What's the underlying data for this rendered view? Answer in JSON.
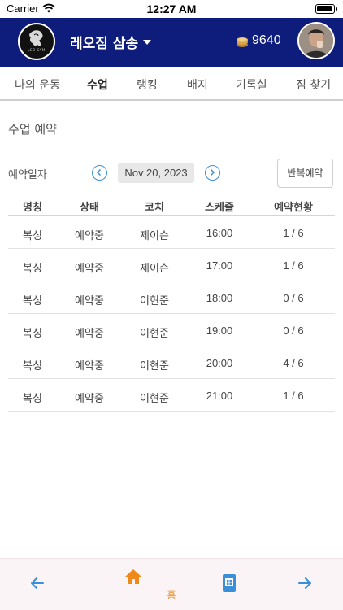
{
  "status_bar": {
    "carrier": "Carrier",
    "time": "12:27 AM"
  },
  "header": {
    "logo_text": "LEO GYM",
    "gym_name": "레오짐 삼송",
    "coins": "9640"
  },
  "tabs": [
    {
      "label": "나의 운동",
      "active": false
    },
    {
      "label": "수업",
      "active": true
    },
    {
      "label": "랭킹",
      "active": false
    },
    {
      "label": "배지",
      "active": false
    },
    {
      "label": "기록실",
      "active": false
    },
    {
      "label": "짐 찾기",
      "active": false
    }
  ],
  "section": {
    "title": "수업 예약"
  },
  "date_selector": {
    "label": "예약일자",
    "date": "Nov 20, 2023",
    "repeat_button": "반복예약"
  },
  "table": {
    "columns": [
      "명칭",
      "상태",
      "코치",
      "스케쥴",
      "예약현황"
    ],
    "rows": [
      [
        "복싱",
        "예약중",
        "제이슨",
        "16:00",
        "1 / 6"
      ],
      [
        "복싱",
        "예약중",
        "제이슨",
        "17:00",
        "1 / 6"
      ],
      [
        "복싱",
        "예약중",
        "이현준",
        "18:00",
        "0 / 6"
      ],
      [
        "복싱",
        "예약중",
        "이현준",
        "19:00",
        "0 / 6"
      ],
      [
        "복싱",
        "예약중",
        "이현준",
        "20:00",
        "4 / 6"
      ],
      [
        "복싱",
        "예약중",
        "이현준",
        "21:00",
        "1 / 6"
      ]
    ]
  },
  "bottom_nav": {
    "home_label": "홈"
  },
  "colors": {
    "header_bg": "#0e1c7c",
    "accent_blue": "#3a8fd8",
    "home_orange": "#ef8a1a"
  }
}
